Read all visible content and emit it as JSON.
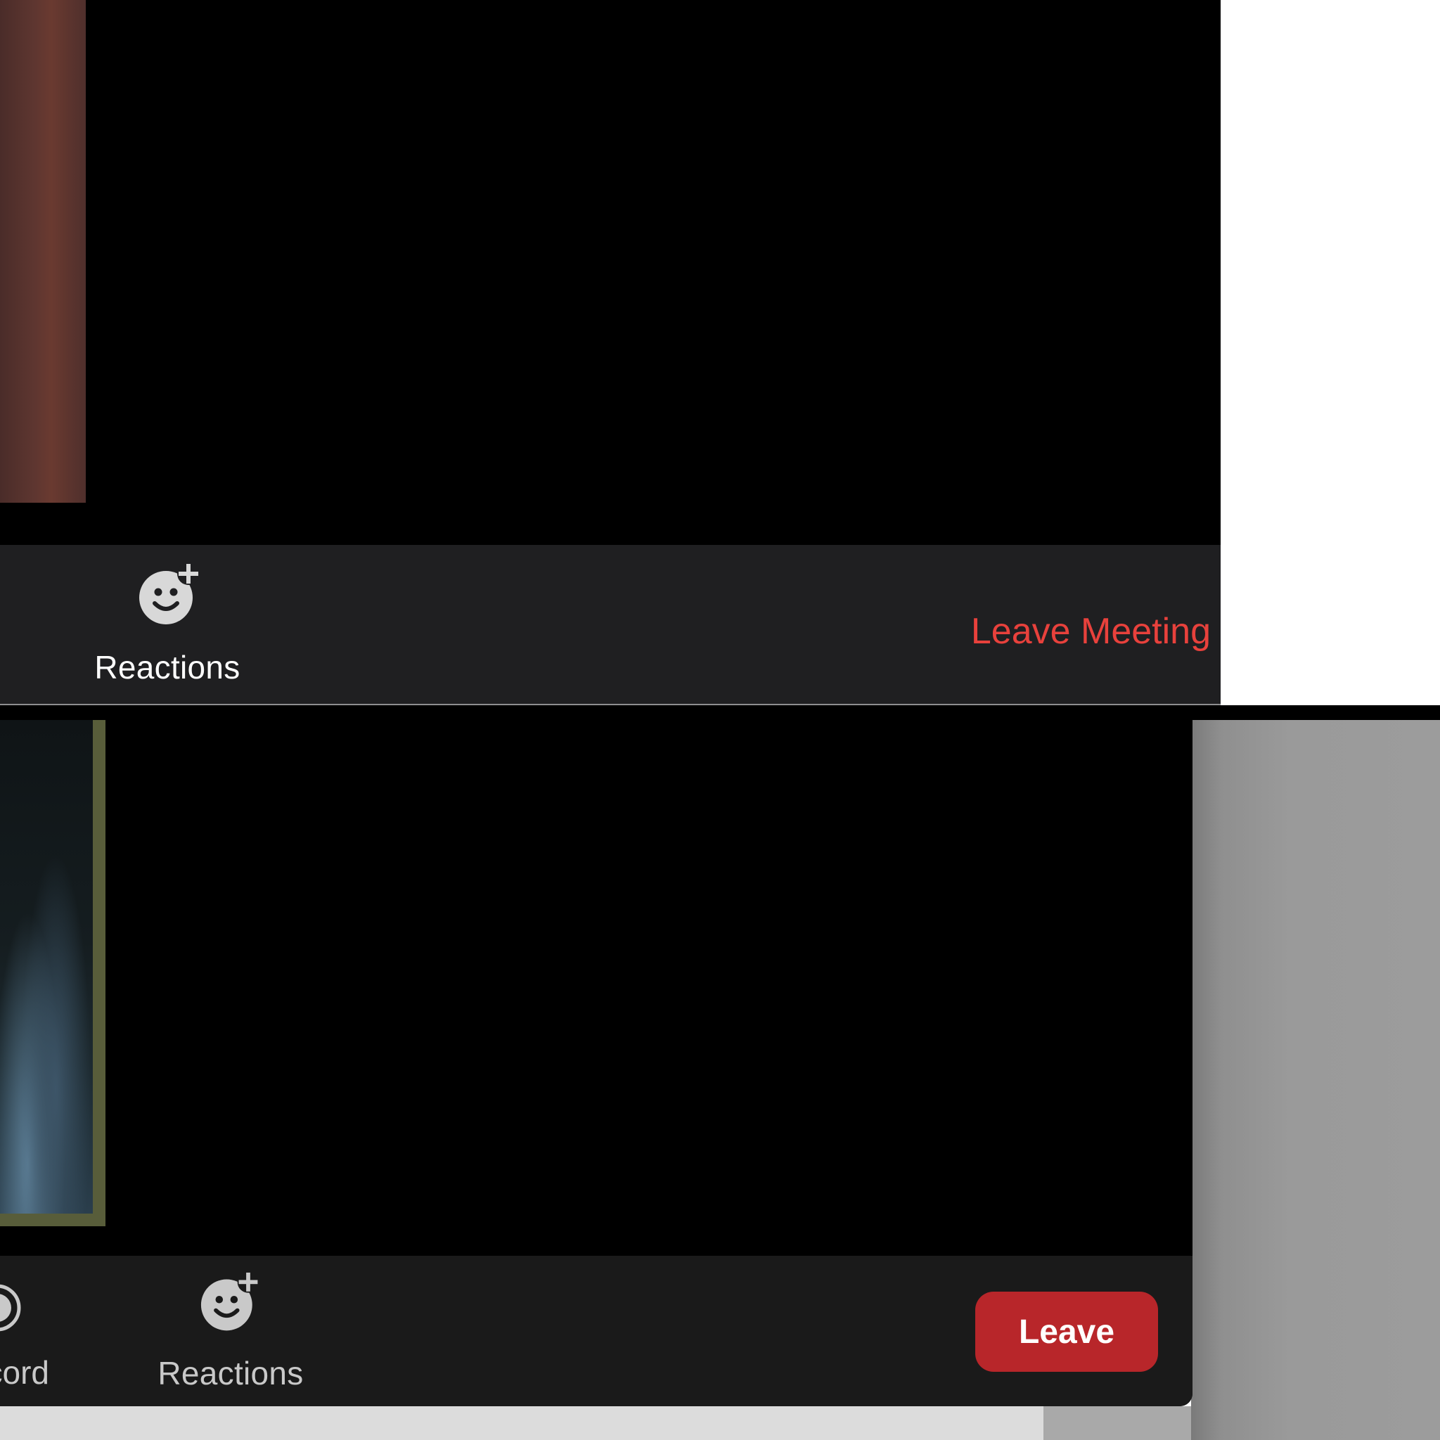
{
  "top_window": {
    "toolbar": {
      "reactions_label": "Reactions",
      "reactions_icon": "emoji-add-icon",
      "leave_label": "Leave Meeting"
    },
    "colors": {
      "toolbar_bg": "#1f1f21",
      "leave_text": "#e8413c",
      "icon": "#d8d8d8"
    }
  },
  "bottom_window": {
    "toolbar": {
      "record_label": "Record",
      "record_icon": "record-icon",
      "reactions_label": "Reactions",
      "reactions_icon": "emoji-add-icon",
      "leave_label": "Leave"
    },
    "colors": {
      "toolbar_bg": "#1a1a1a",
      "leave_button_bg": "#b8262a",
      "label_text": "#c9c9c9"
    }
  }
}
